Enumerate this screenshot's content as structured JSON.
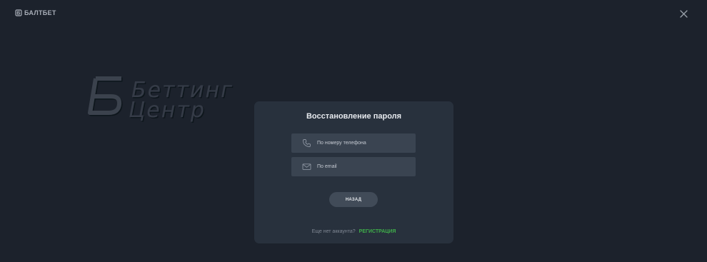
{
  "header": {
    "brand_name": "БАЛТБЕТ",
    "brand_icon": "baltbet-logo-icon",
    "close_icon": "close-icon"
  },
  "watermark": {
    "line1": "Беттинг",
    "line2": "Центр",
    "icon": "betting-center-logo"
  },
  "modal": {
    "title": "Восстановление пароля",
    "options": [
      {
        "label": "По номеру телефона",
        "icon": "phone-icon"
      },
      {
        "label": "По email",
        "icon": "envelope-icon"
      }
    ],
    "back_button": "НАЗАД",
    "footer_question": "Еще нет аккаунта?",
    "register_link": "РЕГИСТРАЦИЯ"
  },
  "colors": {
    "background": "#1c222c",
    "modal_bg": "#28313d",
    "option_bg": "#3a4451",
    "accent_green": "#3fae4a"
  }
}
